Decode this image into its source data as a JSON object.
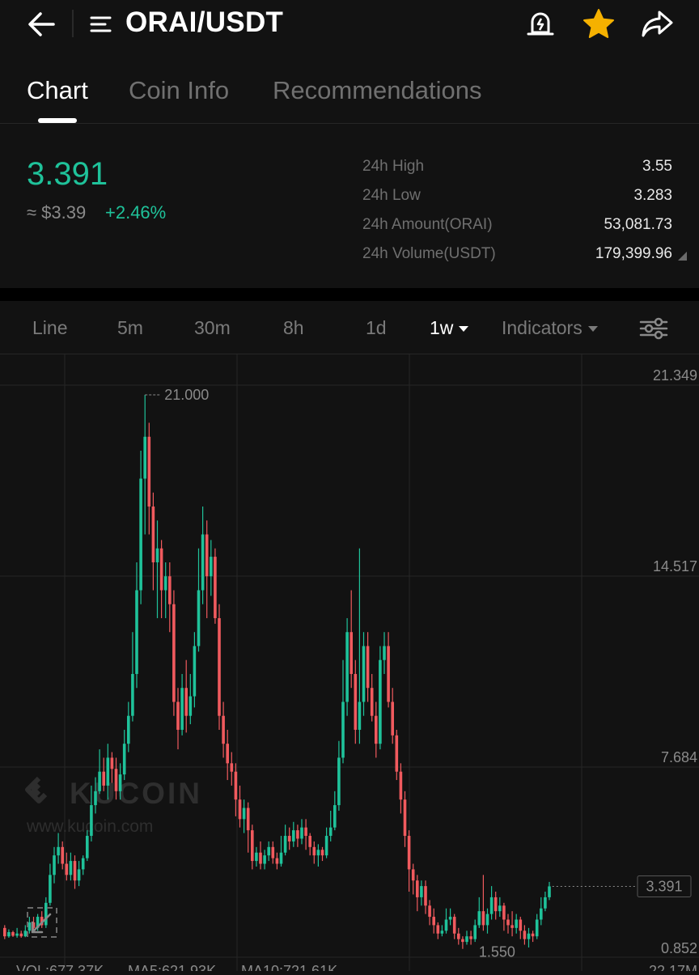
{
  "header": {
    "pair": "ORAI/USDT",
    "icons": {
      "back": "back-arrow-icon",
      "menu": "menu-icon",
      "alert": "price-alert-bell-icon",
      "favorite": "star-icon",
      "share": "share-icon"
    },
    "favorite_color": "#f5b100"
  },
  "tabs": [
    {
      "label": "Chart",
      "active": true
    },
    {
      "label": "Coin Info",
      "active": false
    },
    {
      "label": "Recommendations",
      "active": false
    }
  ],
  "ticker": {
    "last_price": "3.391",
    "usd_price": "≈ $3.39",
    "change": "+2.46%",
    "stats": [
      {
        "label": "24h High",
        "value": "3.55"
      },
      {
        "label": "24h Low",
        "value": "3.283"
      },
      {
        "label": "24h Amount(ORAI)",
        "value": "53,081.73"
      },
      {
        "label": "24h Volume(USDT)",
        "value": "179,399.96"
      }
    ],
    "up_color": "#1fc29a",
    "down_color": "#f05a5e"
  },
  "intervals": {
    "items": [
      {
        "label": "Line",
        "active": false
      },
      {
        "label": "5m",
        "active": false
      },
      {
        "label": "30m",
        "active": false
      },
      {
        "label": "8h",
        "active": false
      },
      {
        "label": "1d",
        "active": false
      },
      {
        "label": "1w",
        "active": true,
        "dropdown": true
      }
    ],
    "indicators_label": "Indicators",
    "settings_icon": "sliders-icon"
  },
  "chart_data": {
    "type": "candlestick",
    "interval": "1w",
    "y_ticks": [
      "21.349",
      "14.517",
      "7.684",
      "0.852"
    ],
    "ylim": [
      0.852,
      21.349
    ],
    "max_label": "21.000",
    "min_label": "1.550",
    "last_price_label": "3.391",
    "watermark": {
      "brand": "KUCOIN",
      "url": "www.kucoin.com"
    },
    "indicator_row": {
      "vol": "VOL:677.37K",
      "ma5": "MA5:621.93K",
      "ma10": "MA10:721.61K",
      "vol_axis": "22.17M"
    },
    "candles": [
      [
        1.9,
        1.6,
        2.0,
        1.5
      ],
      [
        1.6,
        1.75,
        1.85,
        1.55
      ],
      [
        1.75,
        1.62,
        1.8,
        1.58
      ],
      [
        1.62,
        1.7,
        1.9,
        1.55
      ],
      [
        1.7,
        1.6,
        1.8,
        1.55
      ],
      [
        1.6,
        1.8,
        2.0,
        1.57
      ],
      [
        1.8,
        2.1,
        2.3,
        1.7
      ],
      [
        2.1,
        1.9,
        2.3,
        1.8
      ],
      [
        1.9,
        2.3,
        2.4,
        1.8
      ],
      [
        2.3,
        2.0,
        2.5,
        1.9
      ],
      [
        2.0,
        2.8,
        3.0,
        1.9
      ],
      [
        2.8,
        3.8,
        4.2,
        2.7
      ],
      [
        3.8,
        4.5,
        4.8,
        3.5
      ],
      [
        4.5,
        4.8,
        5.3,
        4.2
      ],
      [
        4.8,
        4.2,
        5.0,
        4.0
      ],
      [
        4.2,
        3.8,
        4.6,
        3.6
      ],
      [
        3.8,
        4.3,
        4.6,
        3.6
      ],
      [
        4.3,
        3.6,
        4.5,
        3.3
      ],
      [
        3.6,
        4.0,
        4.3,
        3.4
      ],
      [
        4.0,
        4.4,
        4.5,
        3.8
      ],
      [
        4.4,
        5.2,
        5.4,
        4.3
      ],
      [
        5.2,
        6.3,
        7.0,
        5.0
      ],
      [
        6.3,
        6.8,
        7.3,
        6.0
      ],
      [
        6.8,
        7.5,
        8.3,
        6.7
      ],
      [
        7.5,
        7.0,
        8.0,
        6.8
      ],
      [
        7.0,
        8.0,
        8.5,
        6.5
      ],
      [
        8.0,
        7.6,
        8.2,
        7.1
      ],
      [
        7.6,
        6.8,
        8.0,
        6.5
      ],
      [
        6.8,
        7.4,
        7.8,
        6.5
      ],
      [
        7.4,
        8.5,
        9.0,
        7.2
      ],
      [
        8.5,
        9.5,
        10.0,
        8.2
      ],
      [
        9.5,
        11.0,
        12.5,
        9.3
      ],
      [
        11.0,
        14.0,
        15.0,
        10.5
      ],
      [
        14.0,
        18.0,
        19.0,
        13.5
      ],
      [
        18.0,
        19.5,
        21.0,
        16.0
      ],
      [
        19.5,
        17.0,
        20.0,
        16.0
      ],
      [
        17.0,
        15.0,
        17.5,
        14.0
      ],
      [
        15.0,
        15.5,
        16.5,
        13.0
      ],
      [
        15.5,
        14.0,
        15.8,
        13.0
      ],
      [
        14.0,
        14.5,
        15.0,
        13.0
      ],
      [
        14.5,
        13.5,
        15.0,
        12.5
      ],
      [
        13.5,
        10.0,
        14.0,
        9.5
      ],
      [
        10.0,
        9.0,
        10.5,
        8.3
      ],
      [
        9.0,
        10.5,
        11.0,
        8.8
      ],
      [
        10.5,
        9.5,
        11.5,
        8.9
      ],
      [
        9.5,
        10.2,
        11.0,
        9.2
      ],
      [
        10.2,
        12.0,
        12.5,
        9.8
      ],
      [
        12.0,
        14.0,
        15.5,
        11.8
      ],
      [
        14.0,
        16.0,
        17.0,
        13.5
      ],
      [
        16.0,
        14.5,
        16.5,
        13.0
      ],
      [
        14.5,
        15.2,
        15.8,
        13.8
      ],
      [
        15.2,
        13.0,
        15.5,
        12.8
      ],
      [
        13.0,
        9.5,
        13.5,
        9.0
      ],
      [
        9.5,
        8.5,
        10.0,
        8.0
      ],
      [
        8.5,
        7.8,
        9.0,
        7.2
      ],
      [
        7.8,
        7.5,
        8.2,
        7.0
      ],
      [
        7.5,
        6.5,
        7.8,
        5.9
      ],
      [
        6.5,
        5.8,
        7.0,
        5.5
      ],
      [
        5.8,
        6.2,
        6.5,
        5.3
      ],
      [
        6.2,
        5.4,
        6.4,
        4.6
      ],
      [
        5.4,
        4.3,
        5.6,
        4.0
      ],
      [
        4.3,
        4.6,
        4.8,
        4.1
      ],
      [
        4.6,
        4.2,
        5.0,
        4.0
      ],
      [
        4.2,
        4.5,
        4.7,
        4.0
      ],
      [
        4.5,
        4.8,
        5.0,
        4.3
      ],
      [
        4.8,
        4.4,
        5.0,
        4.2
      ],
      [
        4.4,
        4.2,
        4.6,
        4.0
      ],
      [
        4.2,
        4.6,
        5.2,
        4.1
      ],
      [
        4.6,
        5.2,
        5.6,
        4.5
      ],
      [
        5.2,
        5.0,
        5.5,
        4.7
      ],
      [
        5.0,
        5.4,
        5.7,
        4.8
      ],
      [
        5.4,
        5.1,
        5.6,
        4.8
      ],
      [
        5.1,
        5.5,
        5.8,
        4.9
      ],
      [
        5.5,
        5.2,
        5.8,
        4.7
      ],
      [
        5.2,
        4.8,
        5.3,
        4.5
      ],
      [
        4.8,
        4.5,
        5.0,
        4.2
      ],
      [
        4.5,
        4.7,
        4.9,
        4.1
      ],
      [
        4.7,
        4.5,
        4.8,
        4.3
      ],
      [
        4.5,
        5.2,
        5.5,
        4.4
      ],
      [
        5.2,
        5.5,
        6.1,
        5.0
      ],
      [
        5.5,
        6.3,
        6.8,
        5.4
      ],
      [
        6.3,
        8.0,
        8.6,
        6.1
      ],
      [
        8.0,
        10.0,
        11.5,
        7.8
      ],
      [
        10.0,
        12.5,
        13.0,
        9.5
      ],
      [
        12.5,
        11.0,
        14.0,
        10.5
      ],
      [
        11.0,
        9.0,
        11.5,
        8.5
      ],
      [
        9.0,
        10.0,
        15.5,
        8.5
      ],
      [
        10.0,
        12.0,
        12.5,
        9.5
      ],
      [
        12.0,
        10.5,
        12.5,
        10.0
      ],
      [
        10.5,
        9.5,
        11.0,
        9.3
      ],
      [
        9.5,
        8.5,
        10.0,
        8.0
      ],
      [
        8.5,
        11.5,
        12.0,
        8.3
      ],
      [
        11.5,
        12.0,
        12.5,
        11.0
      ],
      [
        12.0,
        10.0,
        12.5,
        9.8
      ],
      [
        10.0,
        8.8,
        10.5,
        8.5
      ],
      [
        8.8,
        7.5,
        9.0,
        7.2
      ],
      [
        7.5,
        6.5,
        7.8,
        6.0
      ],
      [
        6.5,
        5.2,
        6.8,
        4.8
      ],
      [
        5.2,
        4.0,
        5.4,
        3.2
      ],
      [
        4.0,
        3.6,
        4.2,
        3.1
      ],
      [
        3.6,
        3.0,
        3.8,
        2.5
      ],
      [
        3.0,
        3.4,
        3.6,
        2.7
      ],
      [
        3.4,
        2.7,
        3.6,
        2.4
      ],
      [
        2.7,
        2.3,
        2.9,
        2.0
      ],
      [
        2.3,
        2.0,
        2.6,
        1.7
      ],
      [
        2.0,
        1.7,
        2.1,
        1.5
      ],
      [
        1.7,
        1.8,
        2.0,
        1.6
      ],
      [
        1.8,
        2.2,
        2.6,
        1.7
      ],
      [
        2.2,
        2.3,
        2.6,
        2.0
      ],
      [
        2.3,
        1.7,
        2.4,
        1.5
      ],
      [
        1.7,
        1.5,
        1.9,
        1.3
      ],
      [
        1.5,
        1.4,
        1.6,
        1.15
      ],
      [
        1.4,
        1.6,
        1.8,
        1.3
      ],
      [
        1.6,
        1.5,
        1.8,
        1.3
      ],
      [
        1.5,
        2.0,
        2.2,
        1.4
      ],
      [
        2.0,
        2.5,
        3.0,
        1.9
      ],
      [
        2.5,
        2.0,
        3.8,
        1.8
      ],
      [
        2.0,
        2.4,
        2.6,
        1.7
      ],
      [
        2.4,
        3.0,
        3.4,
        2.2
      ],
      [
        3.0,
        2.5,
        3.2,
        2.2
      ],
      [
        2.5,
        2.7,
        3.0,
        2.3
      ],
      [
        2.7,
        2.2,
        2.8,
        1.8
      ],
      [
        2.2,
        2.0,
        2.4,
        1.7
      ],
      [
        2.0,
        1.9,
        2.5,
        1.6
      ],
      [
        1.9,
        2.2,
        2.4,
        1.7
      ],
      [
        2.2,
        1.8,
        2.3,
        1.5
      ],
      [
        1.8,
        1.5,
        2.0,
        1.3
      ],
      [
        1.5,
        1.7,
        1.9,
        1.2
      ],
      [
        1.7,
        1.6,
        1.8,
        1.4
      ],
      [
        1.6,
        2.2,
        2.4,
        1.5
      ],
      [
        2.2,
        2.6,
        3.0,
        2.0
      ],
      [
        2.6,
        3.0,
        3.2,
        2.5
      ],
      [
        3.0,
        3.39,
        3.55,
        2.9
      ]
    ]
  }
}
